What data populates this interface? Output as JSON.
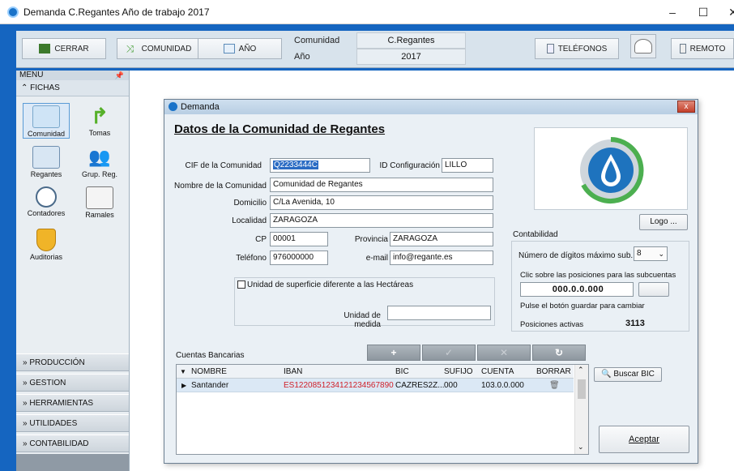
{
  "window": {
    "title": "Demanda C.Regantes  Año de trabajo 2017",
    "minimize": "–",
    "maximize": "☐",
    "close": "✕"
  },
  "toolbar": {
    "cerrar": "CERRAR",
    "comunidad": "COMUNIDAD",
    "anio": "AÑO",
    "telefonos": "TELÉFONOS",
    "remoto": "REMOTO",
    "context": {
      "comunidad_label": "Comunidad",
      "comunidad_value": "C.Regantes",
      "anio_label": "Año",
      "anio_value": "2017"
    }
  },
  "menu": {
    "header": "MENU",
    "fichas": "FICHAS",
    "tiles": [
      {
        "label": "Comunidad"
      },
      {
        "label": "Tomas"
      },
      {
        "label": "Regantes"
      },
      {
        "label": "Grup. Reg."
      },
      {
        "label": "Contadores"
      },
      {
        "label": "Ramales"
      },
      {
        "label": "Auditorias"
      }
    ],
    "sections": [
      "PRODUCCIÓN",
      "GESTION",
      "HERRAMIENTAS",
      "UTILIDADES",
      "CONTABILIDAD"
    ]
  },
  "dialog": {
    "title": "Demanda",
    "close": "x",
    "heading": "Datos de la Comunidad de Regantes",
    "fields": {
      "cif_label": "CIF de la Comunidad",
      "cif_value": "Q2233444C",
      "idconf_label": "ID Configuración",
      "idconf_value": "LILLO",
      "nombre_label": "Nombre de la Comunidad",
      "nombre_value": "Comunidad de Regantes",
      "domicilio_label": "Domicilio",
      "domicilio_value": "C/La Avenida, 10",
      "localidad_label": "Localidad",
      "localidad_value": "ZARAGOZA",
      "cp_label": "CP",
      "cp_value": "00001",
      "provincia_label": "Provincia",
      "provincia_value": "ZARAGOZA",
      "telefono_label": "Teléfono",
      "telefono_value": "976000000",
      "email_label": "e-mail",
      "email_value": "info@regante.es"
    },
    "logo_button": "Logo ...",
    "superficie": {
      "checkbox_label": "Unidad de superficie diferente a las Hectáreas",
      "medida_label": "Unidad de medida",
      "medida_value": ""
    },
    "contabilidad": {
      "title": "Contabilidad",
      "digitos_label": "Número de dígitos máximo sub.",
      "digitos_value": "8",
      "clic_text": "Clic sobre las posiciones para las subcuentas",
      "posiciones_value": "000.0.0.000",
      "pulse_text": "Pulse el botón guardar para cambiar",
      "activas_label": "Posiciones activas",
      "activas_value": "3113"
    },
    "bancos": {
      "title": "Cuentas Bancarias",
      "tools": [
        "+",
        "✓",
        "✕",
        "↻"
      ],
      "columns": [
        "NOMBRE",
        "IBAN",
        "BIC",
        "SUFIJO",
        "CUENTA",
        "BORRAR"
      ],
      "rows": [
        {
          "nombre": "Santander",
          "iban": "ES1220851234121234567890",
          "bic": "CAZRES2Z...",
          "sufijo": "000",
          "cuenta": "103.0.0.000"
        }
      ]
    },
    "buscar_bic": "Buscar BIC",
    "aceptar": "Aceptar"
  },
  "colors": {
    "accent": "#1565c0",
    "iban_red": "#d0202a",
    "selection": "#2b6cc4"
  }
}
